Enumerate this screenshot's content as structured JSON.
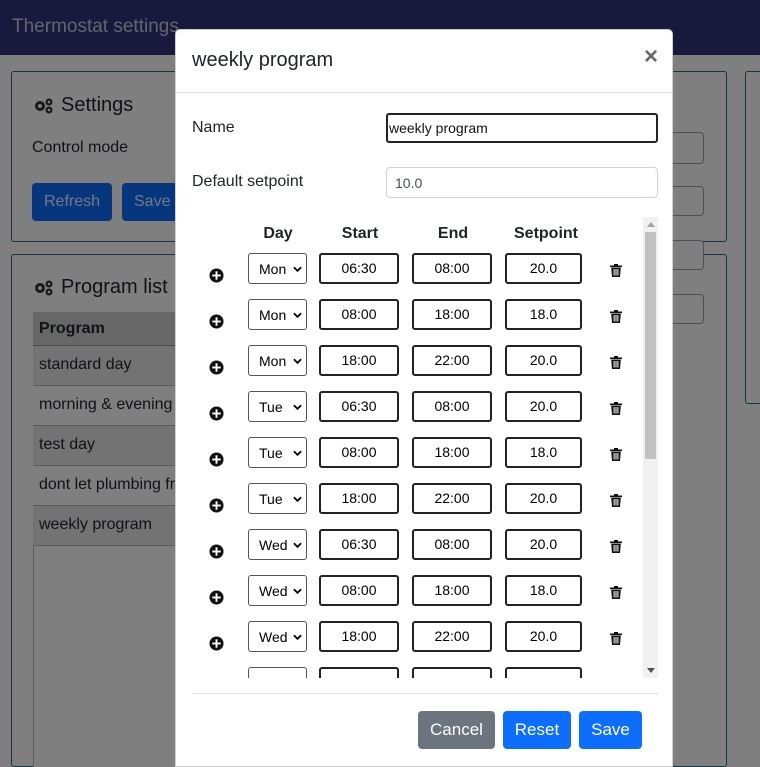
{
  "app": {
    "title": "Thermostat settings",
    "settings_panel": {
      "title": "Settings",
      "control_mode_label": "Control mode",
      "refresh_label": "Refresh",
      "save_label": "Save"
    },
    "program_list": {
      "title": "Program list",
      "header": "Program",
      "items": [
        "standard day",
        "morning & evening",
        "test day",
        "dont let plumbing freeze",
        "weekly program"
      ]
    }
  },
  "modal": {
    "title": "weekly program",
    "close_glyph": "×",
    "name_label": "Name",
    "name_value": "weekly program",
    "default_setpoint_label": "Default setpoint",
    "default_setpoint_value": "10.0",
    "columns": [
      "Day",
      "Start",
      "End",
      "Setpoint"
    ],
    "rows": [
      {
        "day": "Mon",
        "start": "06:30",
        "end": "08:00",
        "setpoint": "20.0"
      },
      {
        "day": "Mon",
        "start": "08:00",
        "end": "18:00",
        "setpoint": "18.0"
      },
      {
        "day": "Mon",
        "start": "18:00",
        "end": "22:00",
        "setpoint": "20.0"
      },
      {
        "day": "Tue",
        "start": "06:30",
        "end": "08:00",
        "setpoint": "20.0"
      },
      {
        "day": "Tue",
        "start": "08:00",
        "end": "18:00",
        "setpoint": "18.0"
      },
      {
        "day": "Tue",
        "start": "18:00",
        "end": "22:00",
        "setpoint": "20.0"
      },
      {
        "day": "Wed",
        "start": "06:30",
        "end": "08:00",
        "setpoint": "20.0"
      },
      {
        "day": "Wed",
        "start": "08:00",
        "end": "18:00",
        "setpoint": "18.0"
      },
      {
        "day": "Wed",
        "start": "18:00",
        "end": "22:00",
        "setpoint": "20.0"
      },
      {
        "day": "",
        "start": "",
        "end": "",
        "setpoint": ""
      }
    ],
    "buttons": {
      "cancel": "Cancel",
      "reset": "Reset",
      "save": "Save"
    }
  },
  "icons": {
    "add": "plus-circle-icon",
    "delete": "trash-icon",
    "settings": "gears-icon"
  },
  "colors": {
    "primary": "#0d6efd",
    "secondary": "#6c757d",
    "topbar": "#33337a",
    "panel_border": "#2c6b73"
  }
}
